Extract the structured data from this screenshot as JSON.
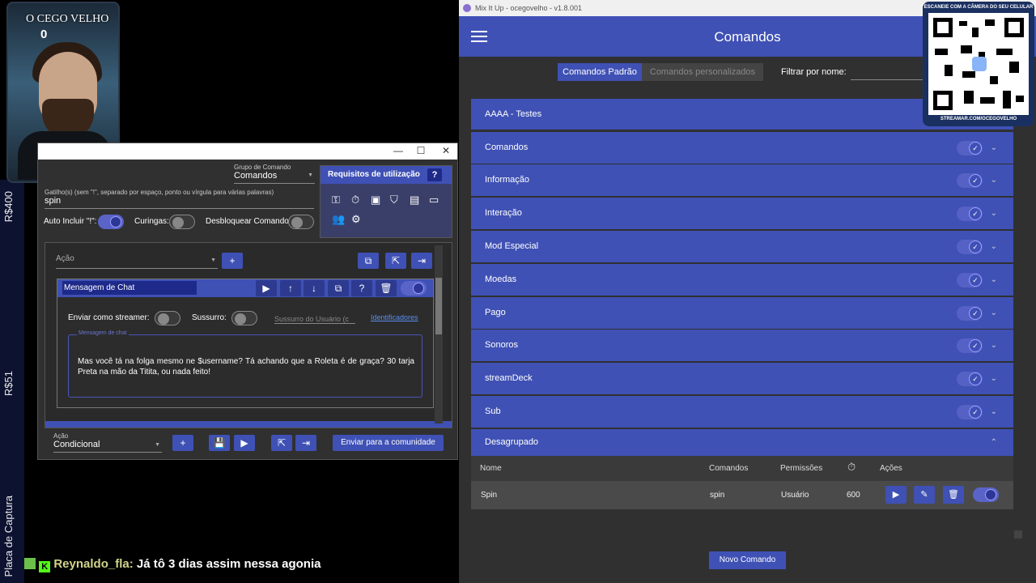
{
  "overlay": {
    "avatar_title": "O CEGO VELHO",
    "avatar_count": "0",
    "side_labels": [
      "R$400",
      "R$51",
      "Placa de Captura"
    ],
    "chat_user": "Reynaldo_fla:",
    "chat_message": "Já tô 3 dias assim nessa agonia",
    "qr_top": "ESCANEIE COM A CÂMERA DO SEU CELULAR",
    "qr_bottom": "STREAMAR.COM/OCEGOVELHO"
  },
  "action_window": {
    "group_label": "Grupo de Comando",
    "group_value": "Comandos",
    "trigger_label": "Gatilho(s) (sem \"!\", separado por espaço, ponto ou vírgula para várias palavras)",
    "trigger_value": "spin",
    "auto_include_label": "Auto Incluir \"!\":",
    "wildcards_label": "Curingas:",
    "unlock_label": "Desbloquear Comando:",
    "requirements_title": "Requisitos de utilização",
    "action_placeholder": "Ação",
    "chat_action_name": "Mensagem de Chat",
    "send_as_streamer_label": "Enviar como streamer:",
    "whisper_label": "Sussurro:",
    "whisper_user_placeholder": "Sussurro do Usuário (c",
    "identifiers_link": "Identificadores",
    "message_label": "Mensagem de chat",
    "message_text": "Mas você tá na folga mesmo ne $username? Tá achando que a Roleta é de graça? 30 tarja Preta na mão da Titita, ou nada feito!",
    "next_action_partial": "Condicional",
    "bottom_action_label": "Ação",
    "bottom_action_value": "Condicional",
    "send_community_button": "Enviar para a comunidade"
  },
  "mixitup": {
    "window_title": "Mix It Up - ocegovelho - v1.8.001",
    "page_title": "Comandos",
    "tab_standard": "Comandos Padrão",
    "tab_custom": "Comandos personalizados",
    "filter_label": "Filtrar por nome:",
    "groups": [
      {
        "name": "AAAA - Testes"
      },
      {
        "name": "Comandos"
      },
      {
        "name": "Informação"
      },
      {
        "name": "Interação"
      },
      {
        "name": "Mod Especial"
      },
      {
        "name": "Moedas"
      },
      {
        "name": "Pago"
      },
      {
        "name": "Sonoros"
      },
      {
        "name": "streamDeck"
      },
      {
        "name": "Sub"
      },
      {
        "name": "Desagrupado"
      }
    ],
    "table_headers": {
      "name": "Nome",
      "commands": "Comandos",
      "permissions": "Permissões",
      "actions": "Ações"
    },
    "row": {
      "name": "Spin",
      "command": "spin",
      "permission": "Usuário",
      "cooldown": "600"
    },
    "new_command_button": "Novo Comando"
  }
}
